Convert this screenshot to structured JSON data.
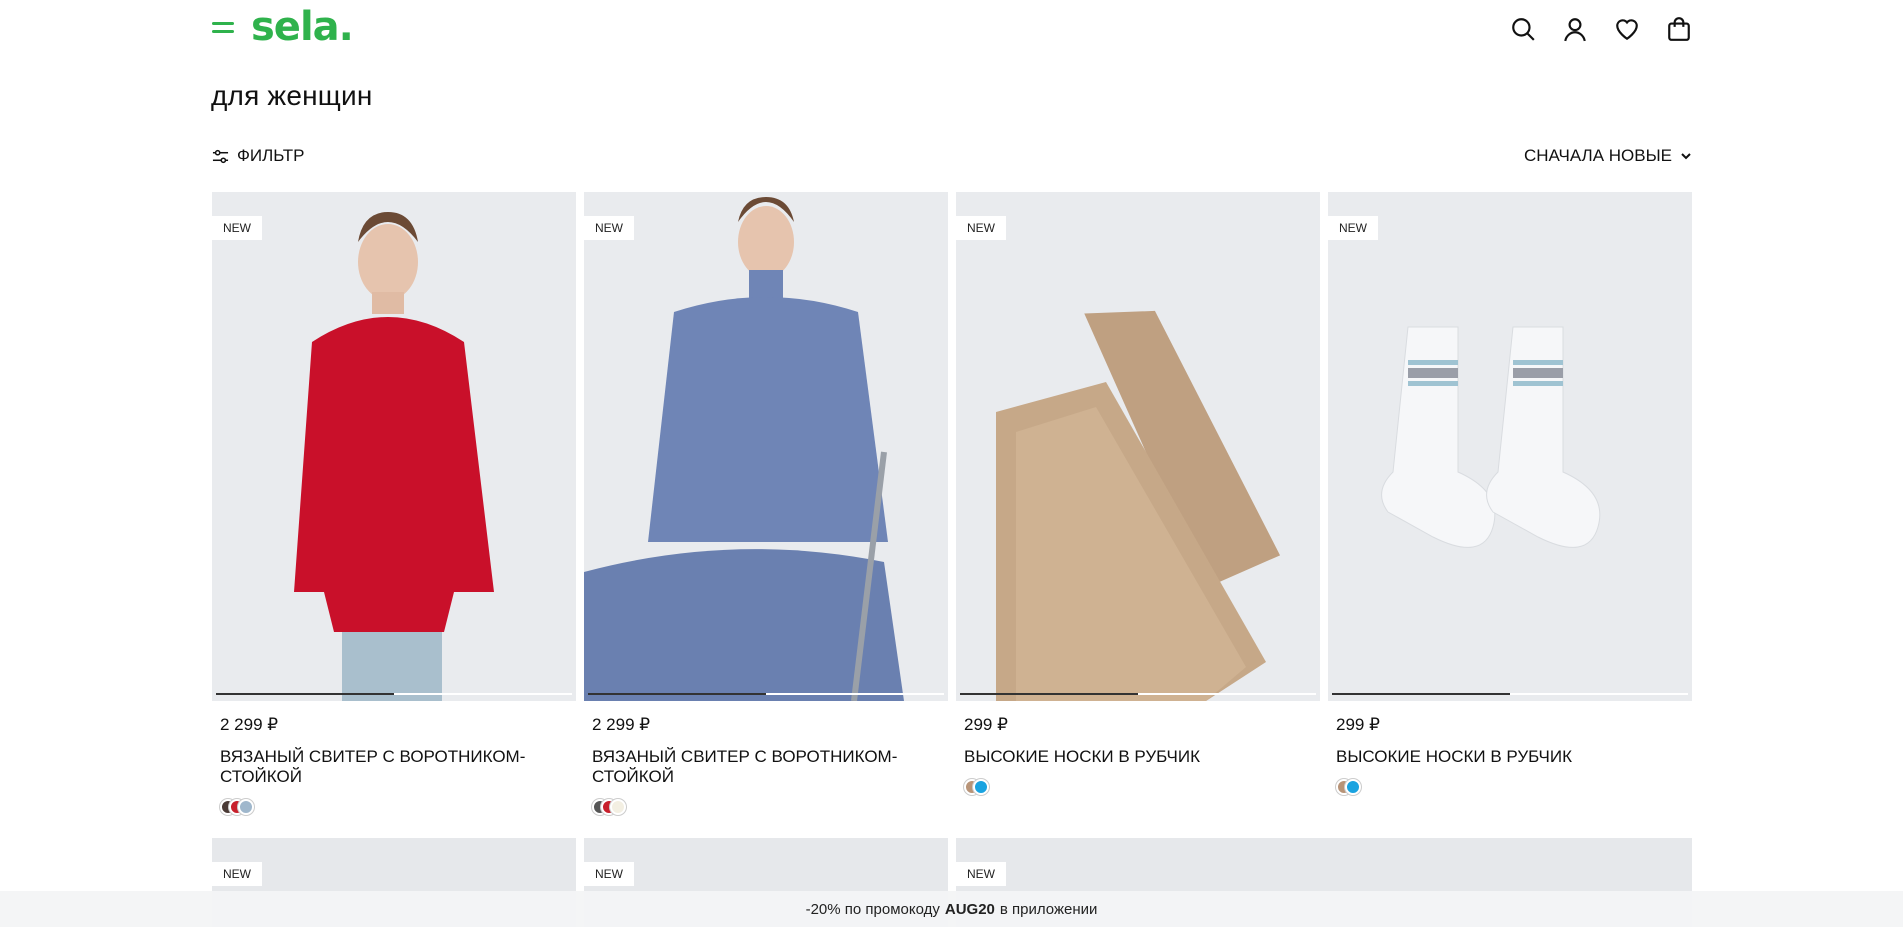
{
  "header": {
    "logo": "sela.",
    "brand_color": "#2fb24c",
    "icons": [
      "search-icon",
      "user-icon",
      "heart-icon",
      "bag-icon"
    ]
  },
  "page": {
    "title": "для женщин",
    "filter_label": "ФИЛЬТР",
    "sort_label": "СНАЧАЛА НОВЫЕ"
  },
  "products": [
    {
      "badge": "NEW",
      "price": "2 299 ₽",
      "name": "ВЯЗАНЫЙ СВИТЕР С ВОРОТНИКОМ-СТОЙКОЙ",
      "image_color": "#c9102a",
      "progress": 0.5,
      "swatches": [
        "#4a3a35",
        "#c8202c",
        "#9fb7cc"
      ]
    },
    {
      "badge": "NEW",
      "price": "2 299 ₽",
      "name": "ВЯЗАНЫЙ СВИТЕР С ВОРОТНИКОМ-СТОЙКОЙ",
      "image_color": "#6f85b6",
      "progress": 0.5,
      "swatches": [
        "#555555",
        "#c8202c",
        "#f3efe2"
      ]
    },
    {
      "badge": "NEW",
      "price": "299 ₽",
      "name": "ВЫСОКИЕ НОСКИ В РУБЧИК",
      "image_color": "#c6a888",
      "progress": 0.5,
      "swatches": [
        "#b89478",
        "#1aa3e0"
      ]
    },
    {
      "badge": "NEW",
      "price": "299 ₽",
      "name": "ВЫСОКИЕ НОСКИ В РУБЧИК",
      "image_color": "#f4f5f7",
      "progress": 0.5,
      "swatches": [
        "#b89478",
        "#1aa3e0"
      ]
    }
  ],
  "row2": [
    {
      "badge": "NEW"
    },
    {
      "badge": "NEW"
    },
    {
      "badge": "NEW"
    }
  ],
  "promo": {
    "prefix": "-20% по промокоду",
    "code": "AUG20",
    "suffix": "в приложении"
  }
}
